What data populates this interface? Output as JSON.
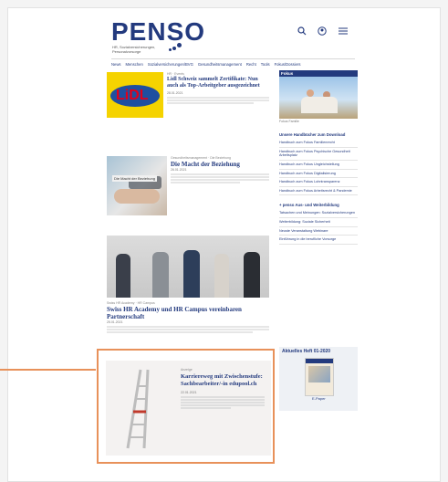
{
  "brand": {
    "logo": "PENSO",
    "tagline": "HR, Sozialversicherungen, Personalvorsorge"
  },
  "nav": [
    "News",
    "Menschen",
    "Sozialversicherungen/BVG",
    "Gesundheitsmanagement",
    "Recht",
    "Tools",
    "Fokus/Dossiers"
  ],
  "articles": [
    {
      "kicker": "HR · Events",
      "title": "Lidl Schweiz sammelt Zertifikate: Nun auch als Top-Arbeitgeber ausgezeichnet",
      "date": "28.01.2021"
    },
    {
      "kicker": "Gesundheitsmanagement · Die Beziehung",
      "title": "Die Macht der Beziehung",
      "overlay": "Die Macht der Beziehung",
      "date": "26.01.2021"
    },
    {
      "kicker": "Swiss HR Academy · HR Campus",
      "title": "Swiss HR Academy und HR Campus vereinbaren Partnerschaft",
      "date": "25.01.2021"
    },
    {
      "kicker": "Anzeige",
      "title": "Karriereweg mit Zwischenstufe: Sachbearbeiter/-in edupool.ch",
      "date": "22.01.2021"
    }
  ],
  "sidebar": {
    "fokus_head": "Fokus",
    "fokus_caption": "Fokus Familie",
    "downloads_title": "Unsere Handbücher zum Download",
    "downloads": [
      "Handbuch zum Fokus Familienrecht",
      "Handbuch zum Fokus Psychische Gesundheit Arbeitsplatz",
      "Handbuch zum Fokus Ungleichstellung",
      "Handbuch zum Fokus Digitalisierung",
      "Handbuch zum Fokus Lohntransparenz",
      "Handbuch zum Fokus Arbeitsrecht & Pandemie"
    ],
    "weiter_title": "+ penso Aus- und Weiterbildung",
    "weiter": [
      "Tatsachen und Meinungen: Sozialversicherungen",
      "Weiterbildung: Soziale Sicherheit",
      "Neuste Veranstaltung Webinare",
      "Einführung in die berufliche Vorsorge"
    ],
    "heft_label": "Aktuelles Heft 01-2020",
    "heft_sub": "E-Paper"
  }
}
